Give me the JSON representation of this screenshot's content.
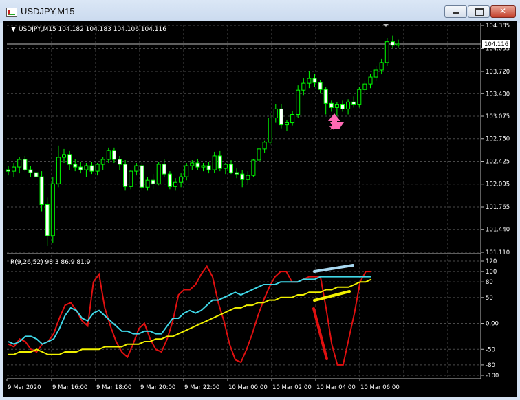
{
  "window": {
    "title": "USDJPY,M15",
    "buttons": {
      "minimize": "minimize",
      "maximize": "maximize",
      "close": "close"
    }
  },
  "main_panel": {
    "header": "USDJPY,M15  104.182 104.183 104.106 104.116",
    "current_price": "104.116",
    "price_ticks": [
      "104.385",
      "104.053",
      "103.720",
      "103.400",
      "103.075",
      "102.750",
      "102.425",
      "102.095",
      "101.765",
      "101.440",
      "101.110"
    ]
  },
  "indicator_panel": {
    "header": "R(9,26,52) 98.3 86.9 81.9",
    "ticks": [
      "120",
      "100",
      "80",
      "50",
      "0.00",
      "-50",
      "-80",
      "-100"
    ]
  },
  "time_axis": [
    "9 Mar 2020",
    "9 Mar 16:00",
    "9 Mar 18:00",
    "9 Mar 20:00",
    "9 Mar 22:00",
    "10 Mar 00:00",
    "10 Mar 02:00",
    "10 Mar 04:00",
    "10 Mar 06:00"
  ],
  "colors": {
    "background": "#000000",
    "bull_candle": "#00ff00",
    "bear_candle": "#ffffff",
    "grid": "#4a4a4a",
    "series_fast": "#e01010",
    "series_mid": "#40d8e8",
    "series_slow": "#f0f000",
    "arrow": "#ff69b4"
  },
  "chart_data": [
    {
      "type": "candlestick",
      "symbol": "USDJPY",
      "timeframe": "M15",
      "ylim": [
        101.11,
        104.385
      ],
      "ohlc": [
        [
          102.3,
          102.36,
          102.22,
          102.28
        ],
        [
          102.28,
          102.4,
          102.2,
          102.34
        ],
        [
          102.34,
          102.48,
          102.25,
          102.45
        ],
        [
          102.45,
          102.5,
          102.28,
          102.3
        ],
        [
          102.3,
          102.36,
          102.2,
          102.26
        ],
        [
          102.26,
          102.32,
          102.15,
          102.2
        ],
        [
          102.2,
          102.28,
          101.7,
          101.8
        ],
        [
          101.8,
          101.9,
          101.2,
          101.35
        ],
        [
          101.35,
          102.2,
          101.25,
          102.1
        ],
        [
          102.1,
          102.65,
          102.05,
          102.48
        ],
        [
          102.48,
          102.6,
          102.4,
          102.52
        ],
        [
          102.52,
          102.58,
          102.3,
          102.38
        ],
        [
          102.38,
          102.45,
          102.28,
          102.34
        ],
        [
          102.34,
          102.42,
          102.25,
          102.3
        ],
        [
          102.3,
          102.4,
          102.2,
          102.36
        ],
        [
          102.36,
          102.42,
          102.24,
          102.28
        ],
        [
          102.28,
          102.4,
          102.22,
          102.38
        ],
        [
          102.38,
          102.48,
          102.3,
          102.45
        ],
        [
          102.45,
          102.62,
          102.4,
          102.58
        ],
        [
          102.58,
          102.62,
          102.4,
          102.45
        ],
        [
          102.45,
          102.5,
          102.3,
          102.38
        ],
        [
          102.38,
          102.44,
          102.0,
          102.06
        ],
        [
          102.06,
          102.3,
          102.02,
          102.28
        ],
        [
          102.28,
          102.4,
          102.22,
          102.36
        ],
        [
          102.36,
          102.42,
          102.0,
          102.05
        ],
        [
          102.05,
          102.2,
          102.0,
          102.15
        ],
        [
          102.15,
          102.24,
          102.02,
          102.1
        ],
        [
          102.1,
          102.42,
          102.08,
          102.38
        ],
        [
          102.38,
          102.45,
          102.2,
          102.24
        ],
        [
          102.24,
          102.28,
          102.02,
          102.06
        ],
        [
          102.06,
          102.18,
          102.0,
          102.12
        ],
        [
          102.12,
          102.25,
          102.05,
          102.2
        ],
        [
          102.2,
          102.4,
          102.15,
          102.36
        ],
        [
          102.36,
          102.44,
          102.3,
          102.4
        ],
        [
          102.4,
          102.46,
          102.3,
          102.34
        ],
        [
          102.34,
          102.4,
          102.28,
          102.36
        ],
        [
          102.36,
          102.42,
          102.25,
          102.3
        ],
        [
          102.3,
          102.56,
          102.26,
          102.5
        ],
        [
          102.5,
          102.58,
          102.28,
          102.32
        ],
        [
          102.32,
          102.4,
          102.24,
          102.38
        ],
        [
          102.38,
          102.44,
          102.24,
          102.26
        ],
        [
          102.26,
          102.32,
          102.18,
          102.24
        ],
        [
          102.24,
          102.3,
          102.05,
          102.16
        ],
        [
          102.16,
          102.28,
          102.1,
          102.22
        ],
        [
          102.22,
          102.46,
          102.2,
          102.44
        ],
        [
          102.44,
          102.62,
          102.38,
          102.6
        ],
        [
          102.6,
          102.72,
          102.54,
          102.7
        ],
        [
          102.7,
          103.12,
          102.66,
          103.05
        ],
        [
          103.05,
          103.25,
          102.98,
          103.18
        ],
        [
          103.18,
          103.25,
          102.9,
          102.95
        ],
        [
          102.95,
          103.02,
          102.86,
          102.98
        ],
        [
          102.98,
          103.15,
          102.94,
          103.1
        ],
        [
          103.1,
          103.52,
          103.05,
          103.45
        ],
        [
          103.45,
          103.62,
          103.38,
          103.55
        ],
        [
          103.55,
          103.72,
          103.48,
          103.62
        ],
        [
          103.62,
          103.68,
          103.5,
          103.56
        ],
        [
          103.56,
          103.6,
          103.4,
          103.46
        ],
        [
          103.46,
          103.5,
          103.1,
          103.26
        ],
        [
          103.26,
          103.3,
          103.14,
          103.2
        ],
        [
          103.2,
          103.28,
          103.08,
          103.24
        ],
        [
          103.24,
          103.3,
          103.14,
          103.18
        ],
        [
          103.18,
          103.32,
          103.1,
          103.28
        ],
        [
          103.28,
          103.36,
          103.2,
          103.24
        ],
        [
          103.24,
          103.5,
          103.2,
          103.46
        ],
        [
          103.46,
          103.58,
          103.4,
          103.54
        ],
        [
          103.54,
          103.68,
          103.48,
          103.64
        ],
        [
          103.64,
          103.8,
          103.58,
          103.74
        ],
        [
          103.74,
          103.9,
          103.68,
          103.85
        ],
        [
          103.85,
          104.2,
          103.8,
          104.15
        ],
        [
          104.15,
          104.24,
          104.06,
          104.1
        ],
        [
          104.1,
          104.18,
          104.06,
          104.116
        ]
      ],
      "signal_arrow_at_bar": 61
    },
    {
      "type": "line",
      "ylim": [
        -100,
        120
      ],
      "series": [
        {
          "color": "#e01010",
          "values": [
            -40,
            -45,
            -30,
            -35,
            -50,
            -55,
            -40,
            -35,
            -20,
            10,
            35,
            40,
            25,
            5,
            -5,
            80,
            95,
            30,
            -5,
            -35,
            -55,
            -65,
            -40,
            -10,
            0,
            -30,
            -50,
            -55,
            -30,
            5,
            55,
            65,
            65,
            75,
            95,
            110,
            90,
            40,
            5,
            -40,
            -70,
            -75,
            -50,
            -20,
            15,
            45,
            70,
            90,
            100,
            100,
            80,
            80,
            85,
            90,
            90,
            90,
            30,
            -40,
            -80,
            -80,
            -30,
            20,
            80,
            100,
            100
          ]
        },
        {
          "color": "#40d8e8",
          "values": [
            -35,
            -40,
            -35,
            -25,
            -25,
            -30,
            -40,
            -35,
            -30,
            -10,
            15,
            30,
            25,
            10,
            5,
            20,
            25,
            15,
            5,
            -5,
            -15,
            -15,
            -20,
            -20,
            -15,
            -15,
            -20,
            -20,
            -5,
            10,
            10,
            20,
            25,
            20,
            25,
            35,
            45,
            45,
            50,
            55,
            60,
            55,
            60,
            65,
            70,
            75,
            75,
            75,
            80,
            80,
            80,
            80,
            85,
            85,
            85,
            90,
            90,
            90,
            90,
            90,
            90,
            90,
            90,
            90,
            90
          ]
        },
        {
          "color": "#f0f000",
          "values": [
            -60,
            -60,
            -55,
            -55,
            -55,
            -50,
            -55,
            -60,
            -60,
            -60,
            -55,
            -55,
            -55,
            -50,
            -50,
            -50,
            -50,
            -45,
            -45,
            -45,
            -45,
            -40,
            -40,
            -40,
            -35,
            -35,
            -30,
            -30,
            -25,
            -25,
            -20,
            -15,
            -10,
            -5,
            0,
            5,
            10,
            15,
            20,
            25,
            30,
            30,
            35,
            35,
            40,
            40,
            45,
            45,
            50,
            50,
            50,
            55,
            55,
            60,
            60,
            60,
            65,
            65,
            70,
            70,
            70,
            75,
            80,
            80,
            85
          ]
        }
      ]
    }
  ]
}
